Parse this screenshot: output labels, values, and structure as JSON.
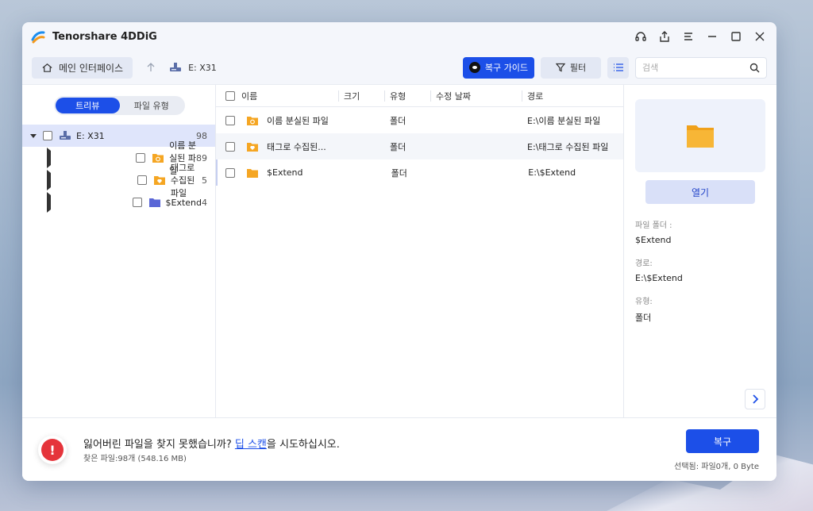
{
  "app": {
    "title": "Tenorshare 4DDiG"
  },
  "toolbar": {
    "home_label": "메인 인터페이스",
    "drive_label": "E: X31",
    "guide_label": "복구 가이드",
    "filter_label": "필터",
    "search_placeholder": "검색"
  },
  "sidebar": {
    "tabs": [
      "트리뷰",
      "파일 유형"
    ],
    "active_tab": "트리뷰",
    "tree": [
      {
        "label": "E: X31",
        "count": "98",
        "expanded": true,
        "icon": "drive-icon"
      },
      {
        "label": "이름 분실된 파일",
        "count": "89",
        "icon": "folder-lost-icon"
      },
      {
        "label": "태그로 수집된 파일",
        "count": "5",
        "icon": "folder-tag-icon"
      },
      {
        "label": "$Extend",
        "count": "4",
        "icon": "folder-purple-icon"
      }
    ]
  },
  "table": {
    "headers": [
      "이름",
      "크기",
      "유형",
      "수정 날짜",
      "경로"
    ],
    "rows": [
      {
        "name": "이름 분실된 파일",
        "size": "",
        "type": "폴더",
        "modified": "",
        "path": "E:\\이름 분실된 파일"
      },
      {
        "name": "태그로 수집된...",
        "size": "",
        "type": "폴더",
        "modified": "",
        "path": "E:\\태그로 수집된 파일"
      },
      {
        "name": "$Extend",
        "size": "",
        "type": "폴더",
        "modified": "",
        "path": "E:\\$Extend"
      }
    ]
  },
  "details": {
    "open_label": "열기",
    "folder_label": "파일 폴더 :",
    "folder_value": "$Extend",
    "path_label": "경로:",
    "path_value": "E:\\$Extend",
    "type_label": "유형:",
    "type_value": "폴더"
  },
  "footer": {
    "message_prefix": "잃어버린 파일을 찾지 못했습니까? ",
    "message_link": "딥 스캔",
    "message_suffix": "을 시도하십시오.",
    "found": "찾은 파일:98개 (548.16 MB)",
    "recover_label": "복구",
    "selected": "선택됨: 파일0개, 0 Byte"
  },
  "colors": {
    "accent": "#1c4fe8",
    "warning": "#e5343b",
    "folder": "#f5a623"
  }
}
